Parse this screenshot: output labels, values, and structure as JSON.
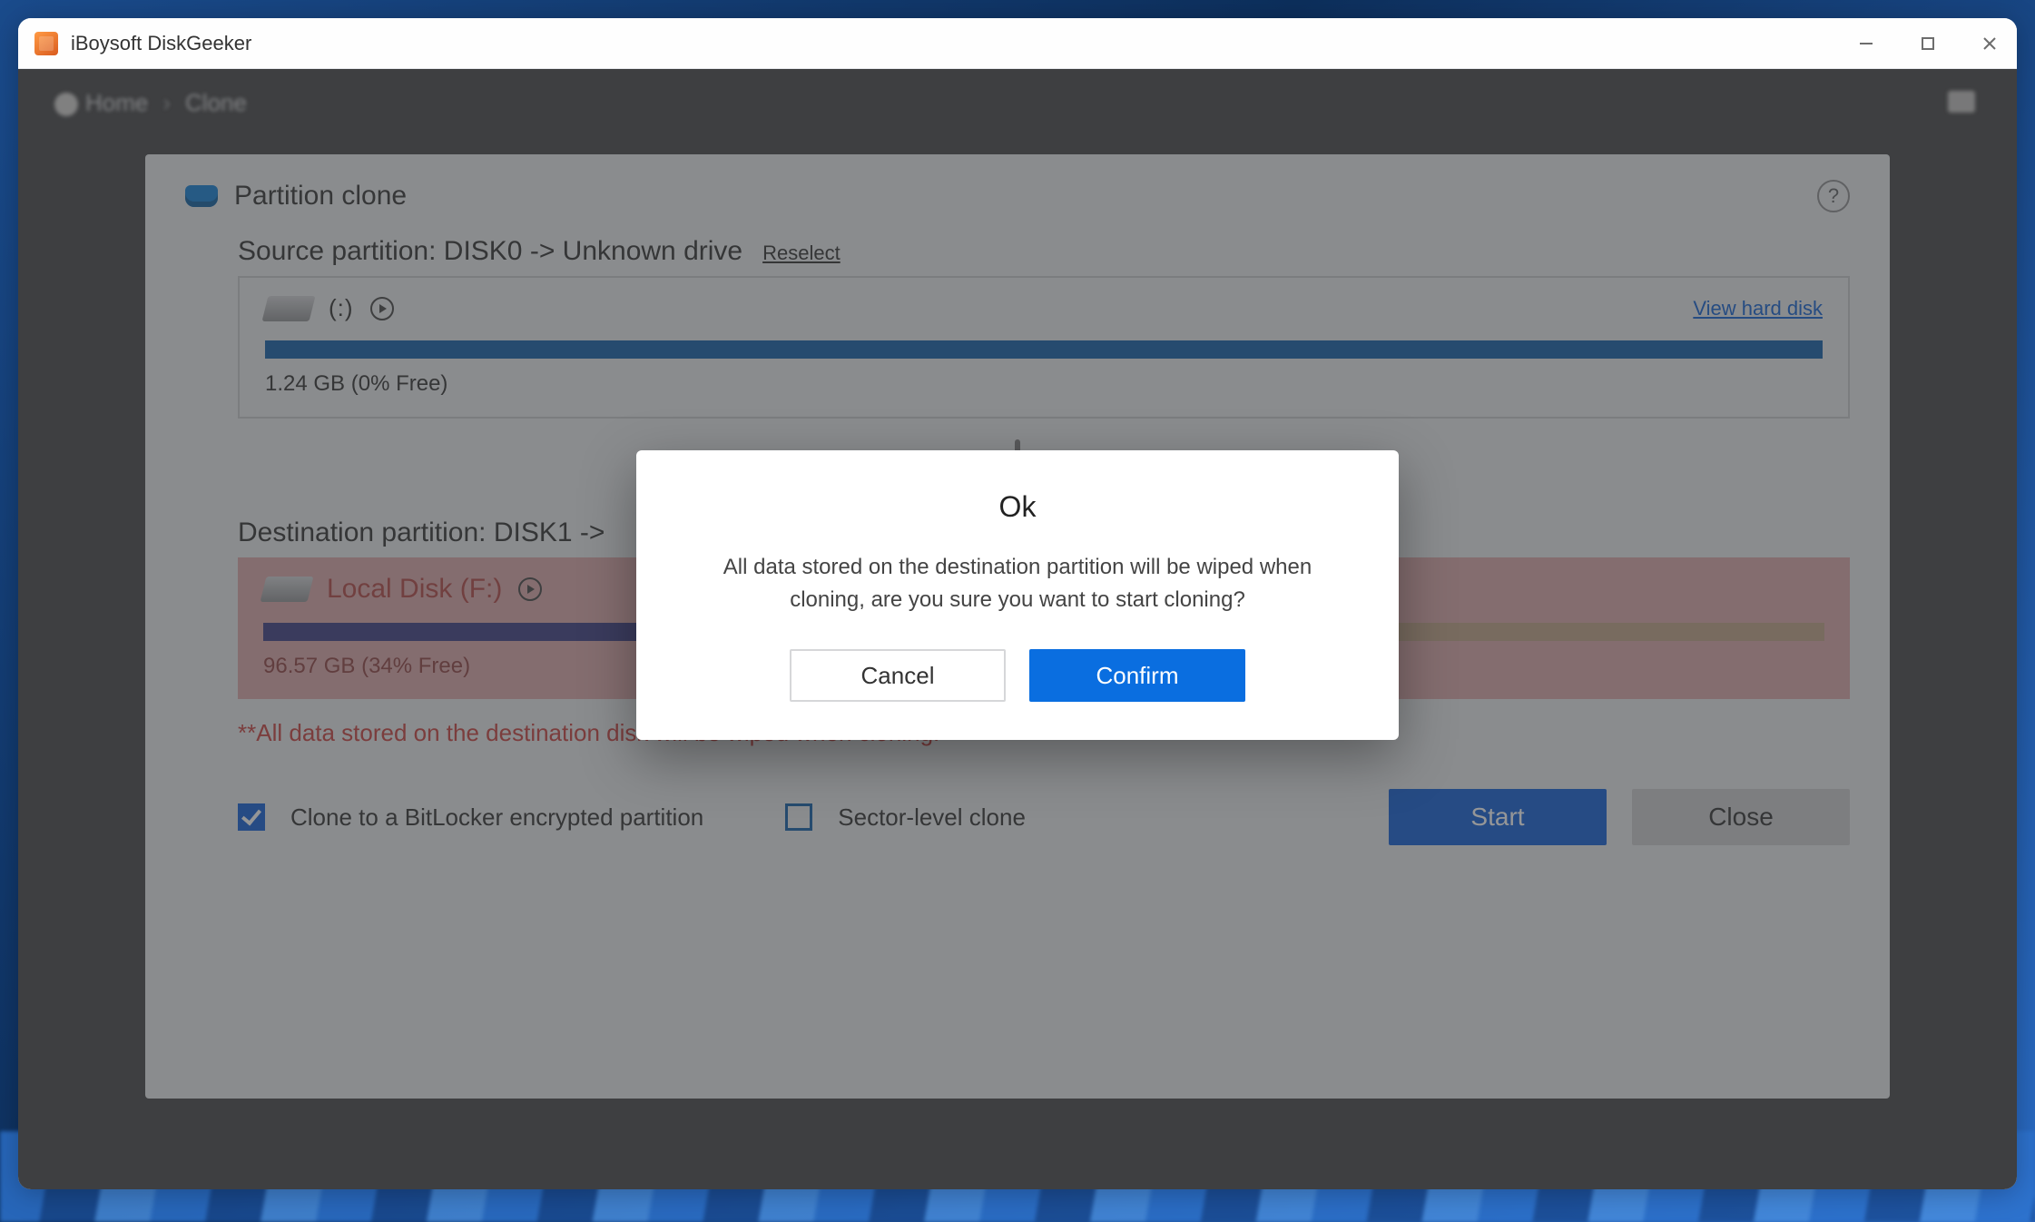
{
  "app": {
    "title": "iBoysoft DiskGeeker"
  },
  "breadcrumb": {
    "home": "Home",
    "page": "Clone"
  },
  "panel": {
    "title": "Partition clone",
    "help_tooltip": "?",
    "source": {
      "label": "Source partition: DISK0 -> Unknown drive",
      "reselect": "Reselect",
      "drive_letter": "(:)",
      "view_link": "View hard disk",
      "usage_text": "1.24 GB (0% Free)"
    },
    "destination": {
      "label": "Destination partition: DISK1 ->",
      "drive_title": "Local Disk (F:)",
      "usage_text": "96.57 GB (34% Free)",
      "fill_percent": 66
    },
    "warning": "**All data stored on the destination disk will be wiped when cloning.",
    "options": {
      "bitlocker_label": "Clone to a BitLocker encrypted partition",
      "bitlocker_checked": true,
      "sector_label": "Sector-level clone",
      "sector_checked": false
    },
    "buttons": {
      "start": "Start",
      "close": "Close"
    }
  },
  "dialog": {
    "title": "Ok",
    "message": "All data stored on the destination partition will be wiped when cloning, are you sure you want to start cloning?",
    "cancel": "Cancel",
    "confirm": "Confirm"
  }
}
